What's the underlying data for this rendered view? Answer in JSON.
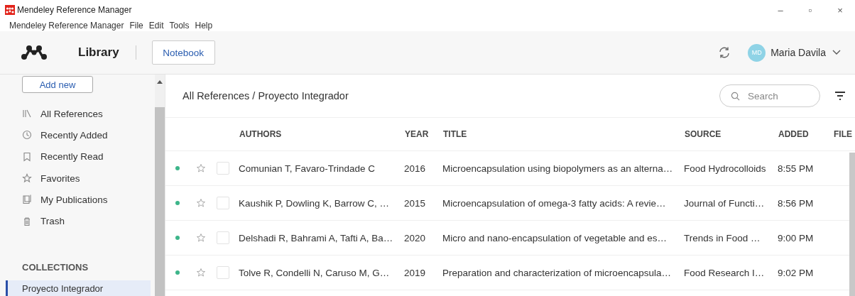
{
  "window": {
    "title": "Mendeley Reference Manager",
    "controls": [
      "–",
      "▫",
      "×"
    ]
  },
  "menu": [
    "Mendeley Reference Manager",
    "File",
    "Edit",
    "Tools",
    "Help"
  ],
  "header": {
    "section": "Library",
    "notebook_button": "Notebook",
    "user": {
      "initials": "MD",
      "name": "Maria Davila"
    }
  },
  "sidebar": {
    "add_button": "Add new",
    "items": [
      {
        "label": "All References",
        "selected": false
      },
      {
        "label": "Recently Added",
        "selected": false
      },
      {
        "label": "Recently Read",
        "selected": false
      },
      {
        "label": "Favorites",
        "selected": false
      },
      {
        "label": "My Publications",
        "selected": false
      },
      {
        "label": "Trash",
        "selected": false
      }
    ],
    "collections_heading": "COLLECTIONS",
    "collections": [
      {
        "label": "Proyecto Integrador",
        "selected": true
      }
    ]
  },
  "main": {
    "breadcrumb": "All References / Proyecto Integrador",
    "search": {
      "placeholder": "Search"
    },
    "table": {
      "columns": [
        "AUTHORS",
        "YEAR",
        "TITLE",
        "SOURCE",
        "ADDED",
        "FILE"
      ],
      "rows": [
        {
          "unread": true,
          "starred": false,
          "checked": false,
          "selected": false,
          "authors": "Comunian T, Favaro-Trindade C",
          "year": "2016",
          "title": "Microencapsulation using biopolymers as an alterna…",
          "source": "Food Hydrocolloids",
          "added": "8:55 PM"
        },
        {
          "unread": true,
          "starred": false,
          "checked": false,
          "selected": false,
          "authors": "Kaushik P, Dowling K, Barrow C, …",
          "year": "2015",
          "title": "Microencapsulation of omega-3 fatty acids: A revie…",
          "source": "Journal of Functi…",
          "added": "8:56 PM"
        },
        {
          "unread": true,
          "starred": false,
          "checked": false,
          "selected": false,
          "authors": "Delshadi R, Bahrami A, Tafti A, Ba…",
          "year": "2020",
          "title": "Micro and nano-encapsulation of vegetable and es…",
          "source": "Trends in Food …",
          "added": "9:00 PM"
        },
        {
          "unread": true,
          "starred": false,
          "checked": false,
          "selected": false,
          "authors": "Tolve R, Condelli N, Caruso M, G…",
          "year": "2019",
          "title": "Preparation and characterization of microencapsula…",
          "source": "Food Research I…",
          "added": "9:02 PM"
        }
      ]
    }
  }
}
